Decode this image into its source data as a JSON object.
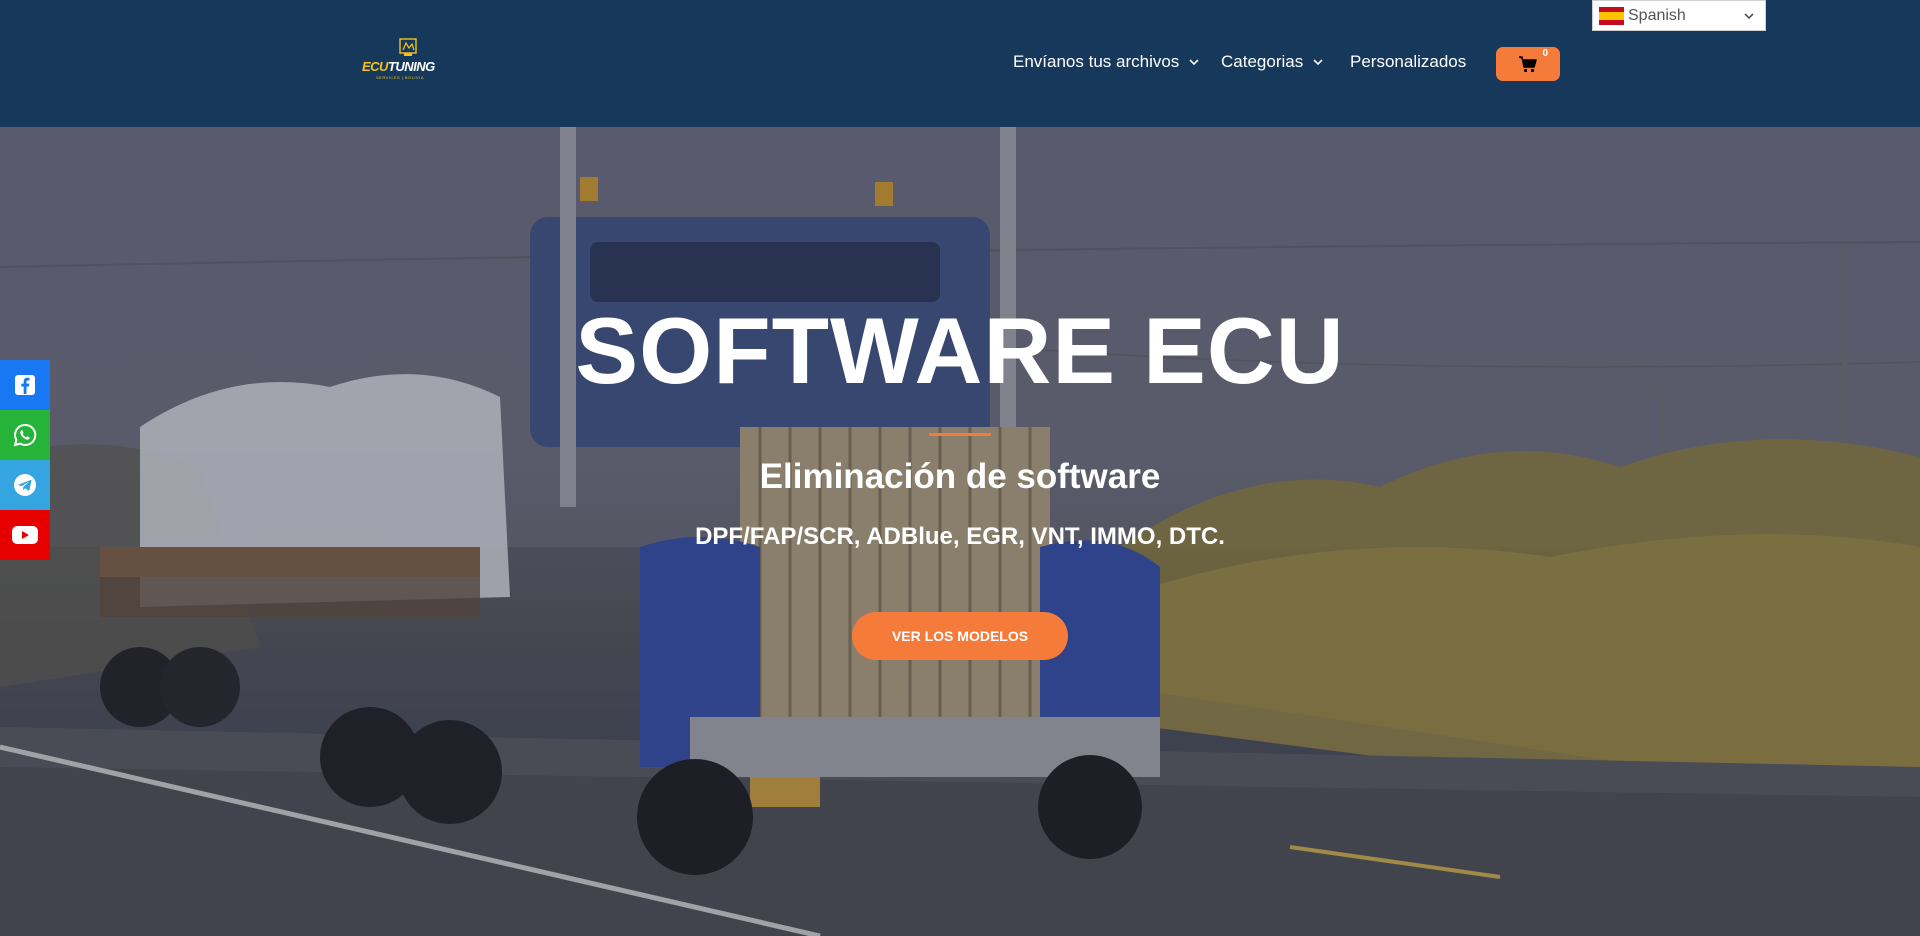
{
  "header": {
    "logo": {
      "brand_part1": "ECU",
      "brand_part2": "TUNING",
      "tagline": "SERVICES | BOLIVIA"
    },
    "nav": [
      {
        "label": "Envíanos tus archivos",
        "has_dropdown": true
      },
      {
        "label": "Categorias",
        "has_dropdown": true
      },
      {
        "label": "Personalizados",
        "has_dropdown": false
      }
    ],
    "cart": {
      "icon": "cart-icon",
      "count": "0"
    },
    "language": {
      "flag": "spain-flag-icon",
      "selected": "Spanish"
    }
  },
  "hero": {
    "title": "SOFTWARE ECU",
    "subtitle": "Eliminación de software",
    "description": "DPF/FAP/SCR, ADBlue, EGR, VNT, IMMO, DTC.",
    "cta_label": "VER LOS MODELOS"
  },
  "social": [
    {
      "name": "facebook-icon",
      "color": "#1877f2"
    },
    {
      "name": "whatsapp-icon",
      "color": "#25b33a"
    },
    {
      "name": "telegram-icon",
      "color": "#34a5e0"
    },
    {
      "name": "youtube-icon",
      "color": "#e60000"
    }
  ],
  "colors": {
    "header_bg": "#16395b",
    "accent": "#f57b3b",
    "logo_yellow": "#f5c21b"
  }
}
